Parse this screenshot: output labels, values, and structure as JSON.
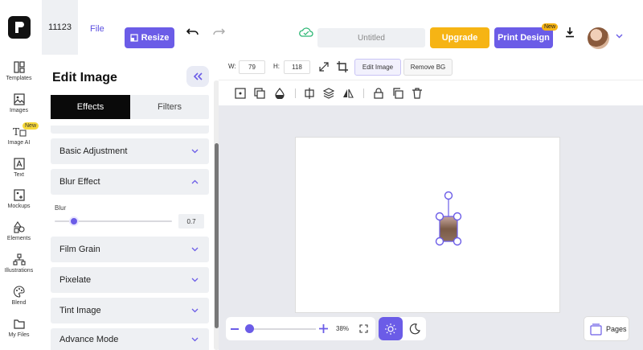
{
  "header": {
    "project_id": "11123",
    "file_label": "File",
    "resize_label": "Resize",
    "document_title": "Untitled",
    "upgrade_label": "Upgrade",
    "print_design_label": "Print Design",
    "print_new_badge": "New"
  },
  "sidebar": {
    "items": [
      {
        "label": "Templates",
        "icon": "templates-icon"
      },
      {
        "label": "Images",
        "icon": "image-icon"
      },
      {
        "label": "Image AI",
        "icon": "text-image-ai-icon",
        "badge": "New"
      },
      {
        "label": "Text",
        "icon": "text-icon"
      },
      {
        "label": "Mockups",
        "icon": "mockups-icon"
      },
      {
        "label": "Elements",
        "icon": "elements-icon"
      },
      {
        "label": "Illustrations",
        "icon": "illustrations-icon"
      },
      {
        "label": "Blend",
        "icon": "palette-icon"
      },
      {
        "label": "My Files",
        "icon": "folder-icon"
      }
    ]
  },
  "edit_panel": {
    "title": "Edit Image",
    "tabs": {
      "effects": "Effects",
      "filters": "Filters"
    },
    "sections": {
      "basic_adjustment": "Basic Adjustment",
      "blur_effect": "Blur Effect",
      "film_grain": "Film Grain",
      "pixelate": "Pixelate",
      "tint_image": "Tint Image",
      "advance_mode": "Advance Mode"
    },
    "blur": {
      "label": "Blur",
      "value": "0.7"
    }
  },
  "properties": {
    "w_label": "W:",
    "w_value": "79",
    "h_label": "H:",
    "h_value": "118",
    "edit_image_label": "Edit Image",
    "remove_bg_label": "Remove BG"
  },
  "canvas": {
    "zoom_value": "38%",
    "pages_label": "Pages"
  },
  "colors": {
    "accent": "#6b5ce7",
    "upgrade": "#f6b414"
  }
}
